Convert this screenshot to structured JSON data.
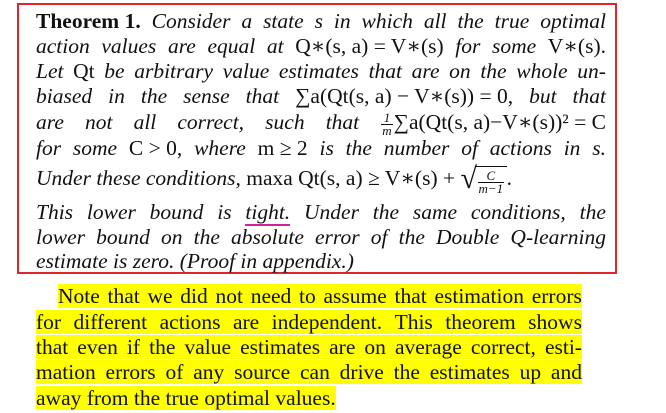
{
  "highlight_color": "#ffff00",
  "box_color": "#e0242c",
  "underline_color": "#d020a0",
  "theorem": {
    "heading": "Theorem 1.",
    "lines": [
      [
        "Consider",
        "a",
        "state",
        "s",
        "in",
        "which",
        "all",
        "the",
        "true",
        "optimal"
      ],
      [
        "action",
        "values",
        "are",
        "equal",
        "at",
        "Q∗(s, a) = V∗(s)",
        "for",
        "some",
        "V∗(s)."
      ],
      [
        "Let",
        "Qt",
        "be",
        "arbitrary",
        "value",
        "estimates",
        "that",
        "are",
        "on",
        "the",
        "whole",
        "un-"
      ],
      [
        "biased",
        "in",
        "the",
        "sense",
        "that",
        "∑a(Qt(s, a) − V∗(s)) = 0,",
        "but",
        "that"
      ],
      [
        "are",
        "not",
        "all",
        "correct,",
        "such",
        "that",
        "∑a(Qt(s, a)−V∗(s))² = C"
      ],
      [
        "for",
        "some",
        "C > 0,",
        "where",
        "m ≥ 2",
        "is",
        "the",
        "number",
        "of",
        "actions",
        "in",
        "s."
      ],
      [
        "Under",
        "these",
        "conditions,",
        "maxa Qt(s, a) ≥ V∗(s) +"
      ],
      [
        "This",
        "lower",
        "bound",
        "is",
        "tight.",
        "Under",
        "the",
        "same",
        "conditions,",
        "the"
      ],
      [
        "lower",
        "bound",
        "on",
        "the",
        "absolute",
        "error",
        "of",
        "the",
        "Double",
        "Q-learning"
      ],
      [
        "estimate is zero. (Proof in appendix.)"
      ]
    ],
    "frac_1_num": "1",
    "frac_1_den": "m",
    "sqrt_num": "C",
    "sqrt_den": "m−1",
    "sqrt_tail": ".",
    "tight_word": "tight"
  },
  "paragraph": {
    "lines": [
      [
        "Note",
        "that",
        "we",
        "did",
        "not",
        "need",
        "to",
        "assume",
        "that",
        "estimation",
        "errors"
      ],
      [
        "for",
        "different",
        "actions",
        "are",
        "independent.",
        "This",
        "theorem",
        "shows"
      ],
      [
        "that",
        "even",
        "if",
        "the",
        "value",
        "estimates",
        "are",
        "on",
        "average",
        "correct,",
        "esti-"
      ],
      [
        "mation",
        "errors",
        "of",
        "any",
        "source",
        "can",
        "drive",
        "the",
        "estimates",
        "up",
        "and"
      ],
      [
        "away from the true optimal values."
      ]
    ]
  }
}
